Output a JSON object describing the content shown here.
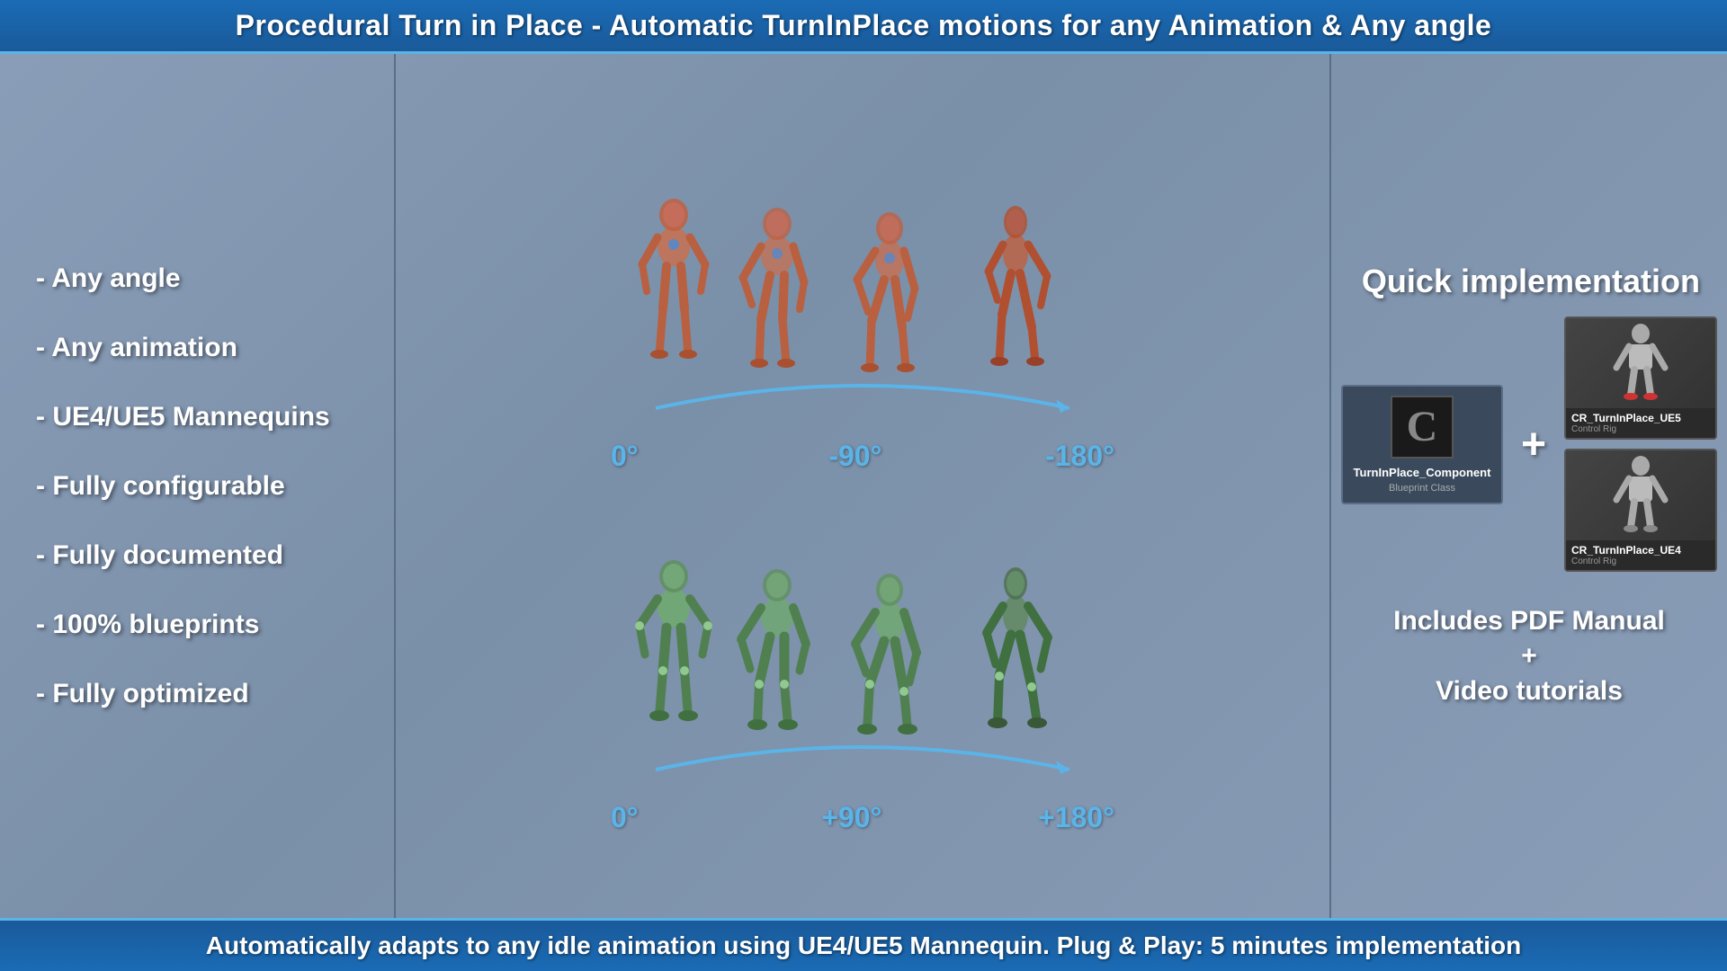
{
  "topBanner": {
    "text": "Procedural Turn in Place - Automatic TurnInPlace motions for any Animation & Any angle"
  },
  "leftPanel": {
    "features": [
      "- Any angle",
      "- Any animation",
      "- UE4/UE5 Mannequins",
      "- Fully configurable",
      "- Fully documented",
      "- 100% blueprints",
      "- Fully optimized"
    ]
  },
  "centerPanel": {
    "topAngles": [
      "0°",
      "-90°",
      "-180°"
    ],
    "bottomAngles": [
      "0°",
      "+90°",
      "+180°"
    ]
  },
  "rightPanel": {
    "quickImplTitle": "Quick implementation",
    "blueprintCard": {
      "name": "TurnInPlace_Component",
      "type": "Blueprint Class",
      "letter": "C"
    },
    "plusSign": "+",
    "mannequins": [
      {
        "name": "CR_TurnInPlace_UE5",
        "type": "Control Rig"
      },
      {
        "name": "CR_TurnInPlace_UE4",
        "type": "Control Rig"
      }
    ],
    "includesLine1": "Includes PDF Manual",
    "includesPlus": "+",
    "includesLine2": "Video tutorials"
  },
  "bottomBanner": {
    "text": "Automatically adapts to any idle animation using UE4/UE5 Mannequin. Plug & Play: 5 minutes implementation"
  }
}
